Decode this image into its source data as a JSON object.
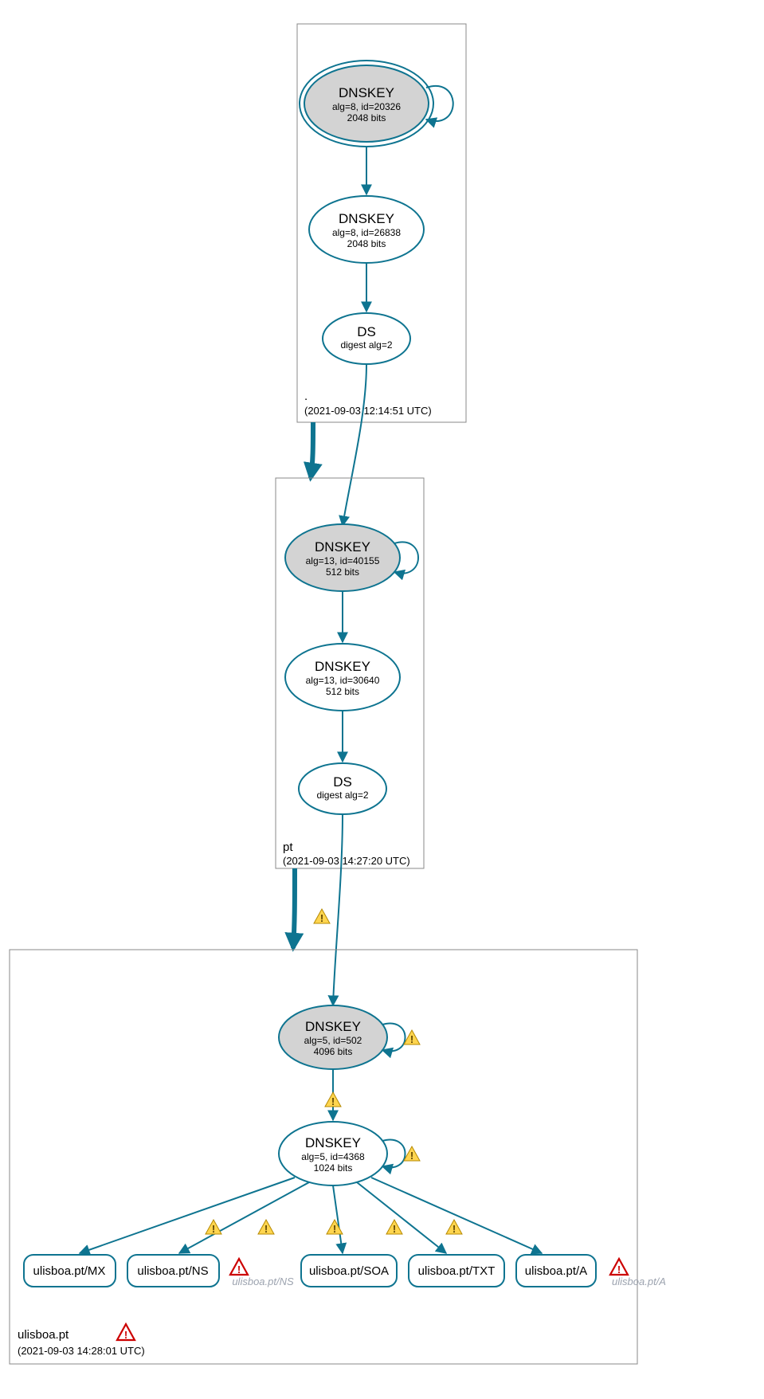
{
  "zones": {
    "root": {
      "name": ".",
      "timestamp": "(2021-09-03 12:14:51 UTC)"
    },
    "pt": {
      "name": "pt",
      "timestamp": "(2021-09-03 14:27:20 UTC)"
    },
    "ulisboa": {
      "name": "ulisboa.pt",
      "timestamp": "(2021-09-03 14:28:01 UTC)"
    }
  },
  "nodes": {
    "root_ksk": {
      "title": "DNSKEY",
      "l1": "alg=8, id=20326",
      "l2": "2048 bits"
    },
    "root_zsk": {
      "title": "DNSKEY",
      "l1": "alg=8, id=26838",
      "l2": "2048 bits"
    },
    "root_ds": {
      "title": "DS",
      "l1": "digest alg=2"
    },
    "pt_ksk": {
      "title": "DNSKEY",
      "l1": "alg=13, id=40155",
      "l2": "512 bits"
    },
    "pt_zsk": {
      "title": "DNSKEY",
      "l1": "alg=13, id=30640",
      "l2": "512 bits"
    },
    "pt_ds": {
      "title": "DS",
      "l1": "digest alg=2"
    },
    "ul_ksk": {
      "title": "DNSKEY",
      "l1": "alg=5, id=502",
      "l2": "4096 bits"
    },
    "ul_zsk": {
      "title": "DNSKEY",
      "l1": "alg=5, id=4368",
      "l2": "1024 bits"
    }
  },
  "rrsets": {
    "mx": "ulisboa.pt/MX",
    "ns": "ulisboa.pt/NS",
    "soa": "ulisboa.pt/SOA",
    "txt": "ulisboa.pt/TXT",
    "a": "ulisboa.pt/A"
  },
  "ghosts": {
    "ns": "ulisboa.pt/NS",
    "a": "ulisboa.pt/A"
  }
}
